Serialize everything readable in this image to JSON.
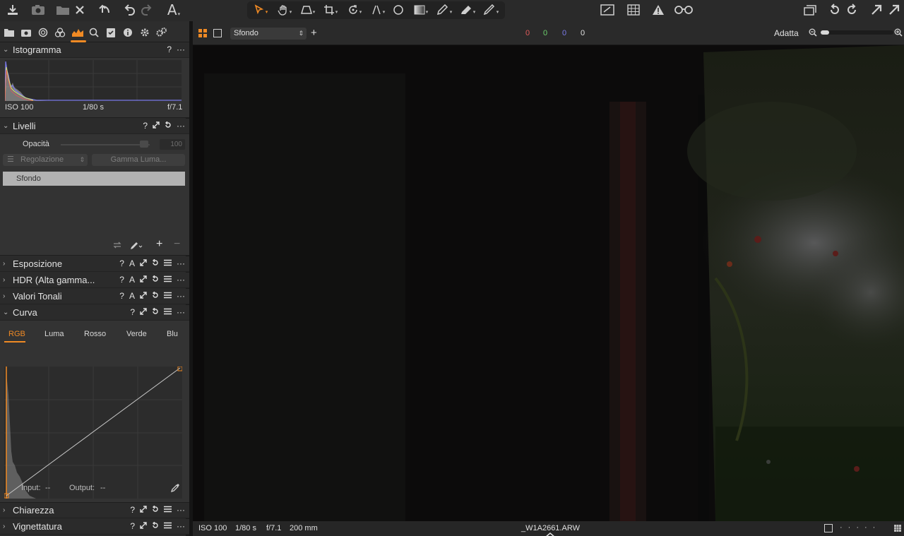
{
  "toolbar": {
    "text_tool_label": "A"
  },
  "sidebar": {
    "histogram": {
      "title": "Istogramma",
      "iso": "ISO 100",
      "shutter": "1/80 s",
      "aperture": "f/7.1"
    },
    "layers": {
      "title": "Livelli",
      "opacity_label": "Opacità",
      "opacity_value": "100",
      "adjust_label": "Regolazione",
      "gamma_label": "Gamma Luma...",
      "layer_name": "Sfondo"
    },
    "panels": {
      "exposure": "Esposizione",
      "hdr": "HDR (Alta gamma...",
      "tonal": "Valori Tonali",
      "curve": "Curva",
      "clarity": "Chiarezza",
      "vignette": "Vignettatura"
    },
    "curve": {
      "tabs": [
        "RGB",
        "Luma",
        "Rosso",
        "Verde",
        "Blu"
      ],
      "active_tab": "RGB",
      "input_label": "Input:",
      "input_value": "--",
      "output_label": "Output:",
      "output_value": "--"
    },
    "action_labels": {
      "help": "?",
      "auto": "A",
      "more": "···"
    }
  },
  "viewer": {
    "layer_select": "Sfondo",
    "readout_r": "0",
    "readout_g": "0",
    "readout_b": "0",
    "readout_l": "0",
    "zoom_label": "Adatta",
    "zoom_level": 0.1,
    "colors": {
      "readout_r": "#e05a5a",
      "readout_g": "#6ccf6c",
      "readout_b": "#7a7ae8",
      "accent": "#f08a24"
    }
  },
  "status": {
    "iso": "ISO 100",
    "shutter": "1/80 s",
    "aperture": "f/7.1",
    "focal": "200 mm",
    "filename": "_W1A2661.ARW"
  }
}
